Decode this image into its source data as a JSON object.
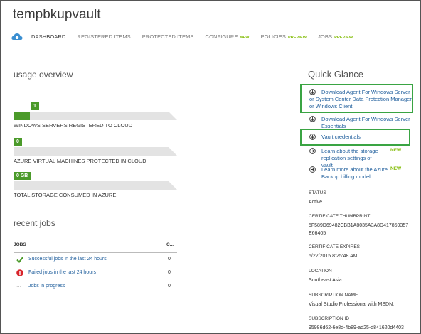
{
  "window": {
    "title": "tempbkupvault"
  },
  "nav": {
    "dashboard": "DASHBOARD",
    "registered": "REGISTERED ITEMS",
    "protected": "PROTECTED ITEMS",
    "configure": "CONFIGURE",
    "configure_tag": "NEW",
    "policies": "POLICIES",
    "policies_tag": "PREVIEW",
    "jobs": "JOBS",
    "jobs_tag": "PREVIEW"
  },
  "usage": {
    "heading": "usage overview",
    "items": [
      {
        "value": "1",
        "label": "WINDOWS SERVERS REGISTERED TO CLOUD",
        "fill_fraction": 0.1
      },
      {
        "value": "0",
        "label": "AZURE VIRTUAL MACHINES PROTECTED IN CLOUD",
        "fill_fraction": 0
      },
      {
        "value": "0 GB",
        "label": "TOTAL STORAGE CONSUMED IN AZURE",
        "fill_fraction": 0
      }
    ]
  },
  "recent_jobs": {
    "heading": "recent jobs",
    "col_jobs": "JOBS",
    "col_count": "C...",
    "rows": [
      {
        "name": "Successful jobs in the last 24 hours",
        "count": "0",
        "icon": "check-icon"
      },
      {
        "name": "Failed jobs in the last 24 hours",
        "count": "0",
        "icon": "error-icon"
      },
      {
        "name": "Jobs in progress",
        "count": "0",
        "icon": "in-progress-icon"
      }
    ]
  },
  "quick_glance": {
    "heading": "Quick Glance",
    "links": [
      {
        "text": "Download Agent For Windows Server or System Center Data Protection Manager or Windows Client",
        "icon": "download-icon",
        "highlighted": true
      },
      {
        "text": "Download Agent For Windows Server Essentials",
        "icon": "download-icon"
      },
      {
        "text": "Vault credentials",
        "icon": "download-icon",
        "highlighted": true
      },
      {
        "text": "Learn about the storage replication settings of vault",
        "icon": "arrow-right-icon",
        "tag": "NEW"
      },
      {
        "text": "Learn more about the Azure Backup billing model",
        "icon": "arrow-right-icon",
        "tag": "NEW"
      }
    ],
    "info": {
      "status_label": "STATUS",
      "status_value": "Active",
      "thumb_label": "CERTIFICATE THUMBPRINT",
      "thumb_line1": "5F589D69482CBB1A8035A3A8D417859357",
      "thumb_line2": "E66405",
      "expires_label": "CERTIFICATE EXPIRES",
      "expires_value": "5/22/2015 8:25:48 AM",
      "location_label": "LOCATION",
      "location_value": "Southeast Asia",
      "sub_name_label": "SUBSCRIPTION NAME",
      "sub_name_value": "Visual Studio Professional with MSDN.",
      "sub_id_label": "SUBSCRIPTION ID",
      "sub_id_value": "95986d62-6e8d-4b89-ad25-d841620d4403"
    }
  },
  "colors": {
    "accent_green": "#4b9a2a",
    "highlight_green": "#3aa443",
    "link_blue": "#1f5e9c",
    "new_tag": "#7fba00"
  }
}
